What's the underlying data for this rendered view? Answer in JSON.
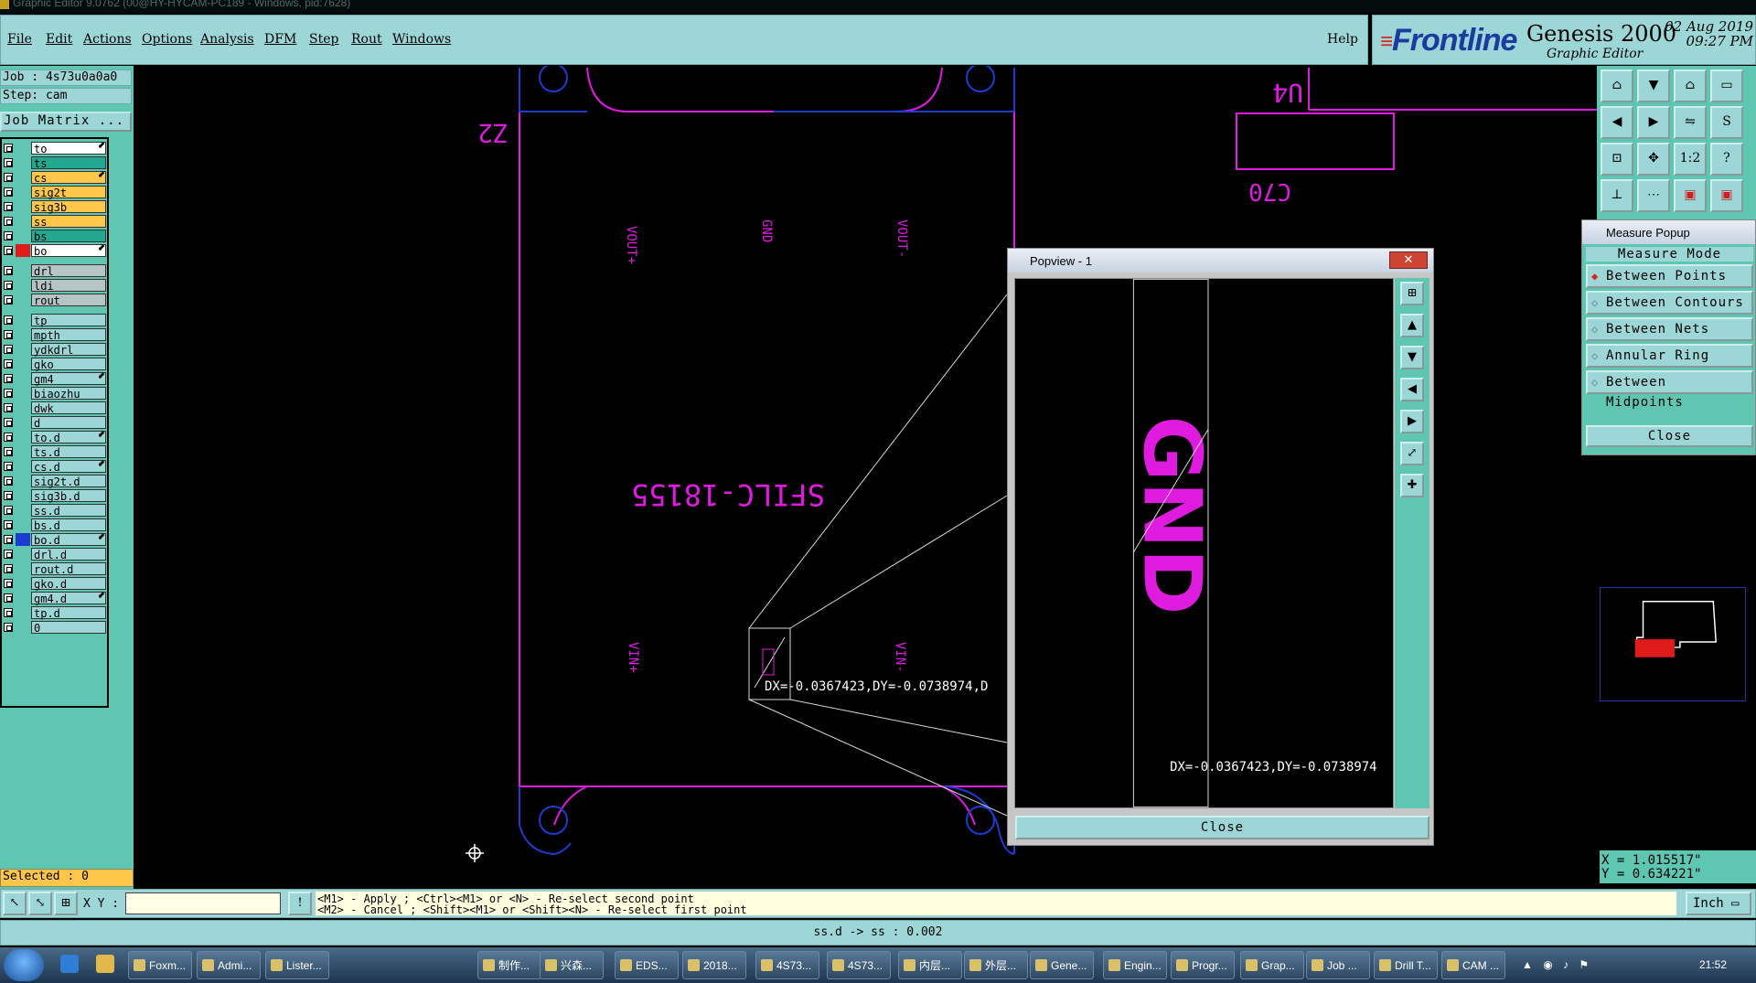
{
  "window_title": "Graphic Editor 9.0762 (00@HY-HYCAM-PC189 - Windows, pid:7628)",
  "menu": [
    "File",
    "Edit",
    "Actions",
    "Options",
    "Analysis",
    "DFM",
    "Step",
    "Rout",
    "Windows"
  ],
  "help": "Help",
  "brand": {
    "logo": "Frontline",
    "product": "Genesis 2000",
    "subtitle": "Graphic Editor",
    "date": "02 Aug 2019",
    "time": "09:27 PM"
  },
  "job": "Job : 4s73u0a0a0",
  "step": "Step: cam",
  "job_matrix": "Job Matrix ...",
  "layers": [
    {
      "name": "to",
      "color": "#ffffff",
      "arrow": true
    },
    {
      "name": "ts",
      "color": "#21a88e",
      "arrow": false
    },
    {
      "name": "cs",
      "color": "#ffc64a",
      "arrow": true
    },
    {
      "name": "sig2t",
      "color": "#ffc64a",
      "arrow": false
    },
    {
      "name": "sig3b",
      "color": "#ffc64a",
      "arrow": false
    },
    {
      "name": "ss",
      "color": "#ffc64a",
      "arrow": false
    },
    {
      "name": "bs",
      "color": "#21a88e",
      "arrow": false
    },
    {
      "name": "bo",
      "color": "#ffffff",
      "arrow": true
    },
    {
      "name": "drl",
      "color": "#b6c4c4",
      "arrow": false
    },
    {
      "name": "ldi",
      "color": "#b6c4c4",
      "arrow": false
    },
    {
      "name": "rout",
      "color": "#b6c4c4",
      "arrow": false
    },
    {
      "name": "tp",
      "color": "#9dd6d6",
      "arrow": false
    },
    {
      "name": "mpth",
      "color": "#9dd6d6",
      "arrow": false
    },
    {
      "name": "ydkdrl",
      "color": "#9dd6d6",
      "arrow": false
    },
    {
      "name": "gko",
      "color": "#9dd6d6",
      "arrow": false
    },
    {
      "name": "gm4",
      "color": "#9dd6d6",
      "arrow": true
    },
    {
      "name": "biaozhu",
      "color": "#9dd6d6",
      "arrow": false
    },
    {
      "name": "dwk",
      "color": "#9dd6d6",
      "arrow": false
    },
    {
      "name": "d",
      "color": "#9dd6d6",
      "arrow": false
    },
    {
      "name": "to.d",
      "color": "#9dd6d6",
      "arrow": true
    },
    {
      "name": "ts.d",
      "color": "#9dd6d6",
      "arrow": false
    },
    {
      "name": "cs.d",
      "color": "#9dd6d6",
      "arrow": true
    },
    {
      "name": "sig2t.d",
      "color": "#9dd6d6",
      "arrow": false
    },
    {
      "name": "sig3b.d",
      "color": "#9dd6d6",
      "arrow": false
    },
    {
      "name": "ss.d",
      "color": "#9dd6d6",
      "arrow": false
    },
    {
      "name": "bs.d",
      "color": "#9dd6d6",
      "arrow": false
    },
    {
      "name": "bo.d",
      "color": "#9dd6d6",
      "arrow": true
    },
    {
      "name": "drl.d",
      "color": "#9dd6d6",
      "arrow": false
    },
    {
      "name": "rout.d",
      "color": "#9dd6d6",
      "arrow": false
    },
    {
      "name": "gko.d",
      "color": "#9dd6d6",
      "arrow": false
    },
    {
      "name": "gm4.d",
      "color": "#9dd6d6",
      "arrow": true
    },
    {
      "name": "tp.d",
      "color": "#9dd6d6",
      "arrow": false
    },
    {
      "name": "0",
      "color": "#9dd6d6",
      "arrow": false
    }
  ],
  "selected": "Selected : 0",
  "canvas": {
    "labels": [
      "Z2",
      "U4",
      "C70",
      "VOUT+",
      "GND",
      "VOUT-",
      "SFILC-18155",
      "VIN+",
      "VIN-"
    ],
    "measure_text": "DX=-0.0367423,DY=-0.0738974,D"
  },
  "popview": {
    "title": "Popview - 1",
    "close_x": "✕",
    "zoom_label": "GND",
    "measure_text": "DX=-0.0367423,DY=-0.0738974",
    "close": "Close"
  },
  "measure_popup": {
    "title": "Measure Popup",
    "heading": "Measure Mode",
    "options": [
      {
        "label": "Between Points",
        "selected": true
      },
      {
        "label": "Between Contours",
        "selected": false
      },
      {
        "label": "Between Nets",
        "selected": false
      },
      {
        "label": "Annular Ring",
        "selected": false
      },
      {
        "label": "Between Midpoints",
        "selected": false
      }
    ],
    "close": "Close"
  },
  "coords": {
    "x": "X = 1.015517\"",
    "y": "Y = 0.634221\""
  },
  "xy_label": "X Y :",
  "hint": {
    "line1": "<M1> - Apply  ; <Ctrl><M1> or <N> - Re-select second point",
    "line2": "<M2> - Cancel ; <Shift><M1> or <Shift><N> - Re-select first point"
  },
  "units": "Inch",
  "status": "ss.d -> ss : 0.002",
  "taskbar": {
    "tasks": [
      "Foxm...",
      "Admi...",
      "Lister...",
      "制作...",
      "兴森...",
      "EDS...",
      "2018...",
      "4S73...",
      "4S73...",
      "内层...",
      "外层...",
      "Gene...",
      "Engin...",
      "Progr...",
      "Grap...",
      "Job ...",
      "Drill T...",
      "CAM ..."
    ],
    "clock": "21:52"
  }
}
